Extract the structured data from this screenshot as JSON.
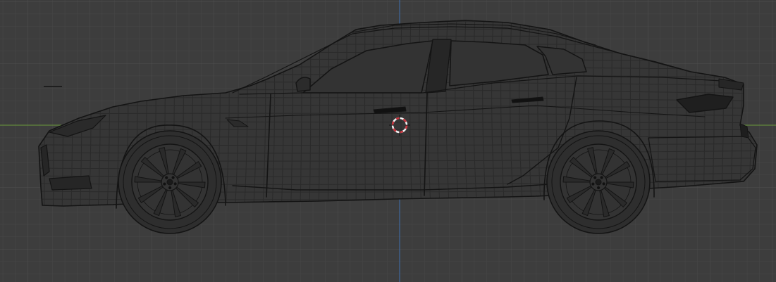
{
  "viewport": {
    "background": "#3d3d3d",
    "grid_minor_color": "#474747",
    "grid_major_color": "#4f4f4f",
    "axis_x_color": "#6a9a3c",
    "axis_y_color": "#3f6fb0"
  },
  "model": {
    "wire_color": "#141414",
    "cursor_color_a": "#c8323c",
    "cursor_color_b": "#f2f2f2",
    "icon": "car-wireframe"
  }
}
